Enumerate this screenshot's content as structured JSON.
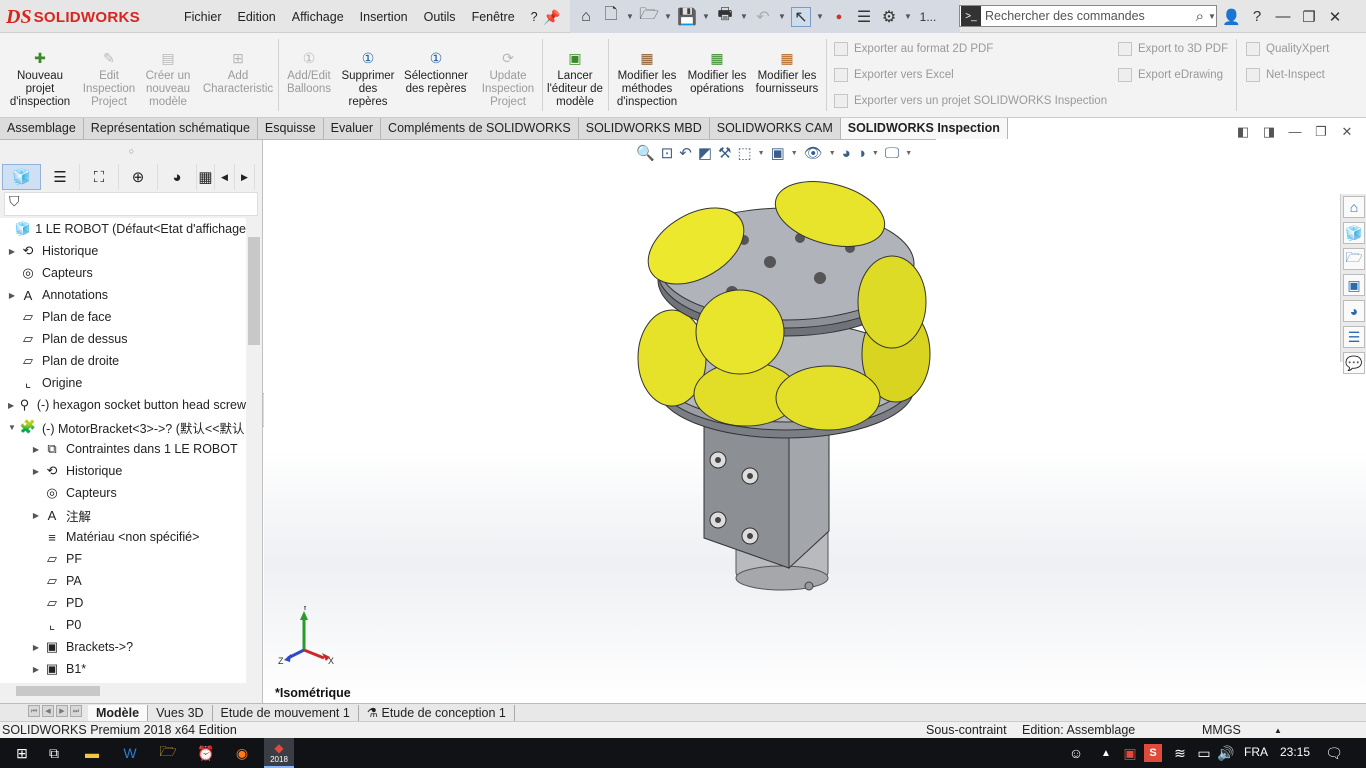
{
  "app": {
    "logo_ds": "DS",
    "logo_name": "SOLIDWORKS"
  },
  "menu": [
    "Fichier",
    "Edition",
    "Affichage",
    "Insertion",
    "Outils",
    "Fenêtre",
    "?"
  ],
  "quick_access": {
    "more_label": "1..."
  },
  "search": {
    "placeholder": "Rechercher des commandes"
  },
  "ribbon": {
    "buttons": [
      {
        "label": "Nouveau projet d'inspection",
        "enabled": true
      },
      {
        "label": "Edit Inspection Project",
        "enabled": false
      },
      {
        "label": "Créer un nouveau modèle",
        "enabled": false
      },
      {
        "label": "Add Characteristic",
        "enabled": false
      },
      {
        "label": "Add/Edit Balloons",
        "enabled": false
      },
      {
        "label": "Supprimer des repères",
        "enabled": true
      },
      {
        "label": "Sélectionner des repères",
        "enabled": true
      },
      {
        "label": "Update Inspection Project",
        "enabled": false
      },
      {
        "label": "Lancer l'éditeur de modèle",
        "enabled": true
      },
      {
        "label": "Modifier les méthodes d'inspection",
        "enabled": true
      },
      {
        "label": "Modifier les opérations",
        "enabled": true
      },
      {
        "label": "Modifier les fournisseurs",
        "enabled": true
      }
    ],
    "small_items": [
      "Exporter au format 2D PDF",
      "Exporter vers Excel",
      "Exporter vers un projet SOLIDWORKS Inspection",
      "Export to 3D PDF",
      "Export eDrawing",
      "QualityXpert",
      "Net-Inspect"
    ]
  },
  "command_tabs": [
    "Assemblage",
    "Représentation schématique",
    "Esquisse",
    "Evaluer",
    "Compléments de SOLIDWORKS",
    "SOLIDWORKS MBD",
    "SOLIDWORKS CAM",
    "SOLIDWORKS Inspection"
  ],
  "active_command_tab": "SOLIDWORKS Inspection",
  "feature_tree": [
    {
      "label": "1 LE ROBOT  (Défaut<Etat d'affichage",
      "icon": "assembly-icon",
      "level": 0,
      "expander": ""
    },
    {
      "label": "Historique",
      "icon": "history-icon",
      "level": 1,
      "expander": "▶"
    },
    {
      "label": "Capteurs",
      "icon": "sensor-icon",
      "level": 1,
      "expander": ""
    },
    {
      "label": "Annotations",
      "icon": "annotation-icon",
      "level": 1,
      "expander": "▶"
    },
    {
      "label": "Plan de face",
      "icon": "plane-icon",
      "level": 1,
      "expander": ""
    },
    {
      "label": "Plan de dessus",
      "icon": "plane-icon",
      "level": 1,
      "expander": ""
    },
    {
      "label": "Plan de droite",
      "icon": "plane-icon",
      "level": 1,
      "expander": ""
    },
    {
      "label": "Origine",
      "icon": "origin-icon",
      "level": 1,
      "expander": ""
    },
    {
      "label": "(-) hexagon socket button head screw",
      "icon": "screw-icon",
      "level": 1,
      "expander": "▶"
    },
    {
      "label": "(-) MotorBracket<3>->? (默认<<默认",
      "icon": "part-icon",
      "level": 1,
      "expander": "▼"
    },
    {
      "label": "Contraintes dans 1 LE ROBOT",
      "icon": "mates-icon",
      "level": 2,
      "expander": "▶"
    },
    {
      "label": "Historique",
      "icon": "history-icon",
      "level": 2,
      "expander": "▶"
    },
    {
      "label": "Capteurs",
      "icon": "sensor-icon",
      "level": 2,
      "expander": ""
    },
    {
      "label": "注解",
      "icon": "annotation-icon",
      "level": 2,
      "expander": "▶"
    },
    {
      "label": "Matériau <non spécifié>",
      "icon": "material-icon",
      "level": 2,
      "expander": ""
    },
    {
      "label": "PF",
      "icon": "plane-icon",
      "level": 2,
      "expander": ""
    },
    {
      "label": "PA",
      "icon": "plane-icon",
      "level": 2,
      "expander": ""
    },
    {
      "label": "PD",
      "icon": "plane-icon",
      "level": 2,
      "expander": ""
    },
    {
      "label": "P0",
      "icon": "origin-icon",
      "level": 2,
      "expander": ""
    },
    {
      "label": "Brackets->?",
      "icon": "feature-icon",
      "level": 2,
      "expander": "▶"
    },
    {
      "label": "B1*",
      "icon": "feature-icon",
      "level": 2,
      "expander": "▶"
    }
  ],
  "viewport": {
    "view_label": "*Isométrique",
    "triad": {
      "x": "X",
      "y": "Y",
      "z": "Z"
    }
  },
  "bottom_tabs": [
    "Modèle",
    "Vues 3D",
    "Etude de mouvement 1",
    "Etude de conception 1"
  ],
  "active_bottom_tab": "Modèle",
  "status": {
    "edition": "SOLIDWORKS Premium 2018 x64 Edition",
    "constraint": "Sous-contraint",
    "mode": "Edition: Assemblage",
    "units": "MMGS"
  },
  "taskbar": {
    "lang": "FRA",
    "time": "23:15",
    "sw_badge": "2018"
  }
}
